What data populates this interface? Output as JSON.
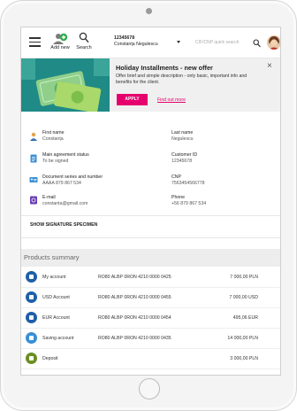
{
  "topbar": {
    "add_new_label": "Add new",
    "search_label": "Search",
    "client_id": "12345678",
    "client_name": "Constanța Negulescu",
    "quick_search_placeholder": "CIF/CNP quick search"
  },
  "banner": {
    "title": "Holiday Installments - new offer",
    "description": "Offer brief and simple description - only basic, important info and benefits for the client.",
    "apply_label": "APPLY",
    "find_out_more": "Find out more",
    "close_symbol": "×"
  },
  "client": {
    "first_name_label": "First name",
    "first_name": "Constanța",
    "last_name_label": "Last name",
    "last_name": "Negulescu",
    "agreement_label": "Main agreement status",
    "agreement_status": "To be signed",
    "customer_id_label": "Customer ID",
    "customer_id": "12345678",
    "document_label": "Document series and number",
    "document_value": "AAAA 879 867 534",
    "cnp_label": "CNP",
    "cnp_value": "7563454566778",
    "email_label": "E-mail",
    "email_value": "constanta@gmail.com",
    "phone_label": "Phone",
    "phone_value": "+56 879 867 534"
  },
  "signature_label": "SHOW SIGNATURE SPECIMEN",
  "products": {
    "title": "Products summary",
    "rows": [
      {
        "name": "My account",
        "iban": "RO80 ALBP 0RON 4210 0000 0425",
        "amount": "7 000,00 PLN",
        "color": "#1f5fa8"
      },
      {
        "name": "USD Account",
        "iban": "RO80 ALBP 0RON 4210 0000 0455",
        "amount": "7 000,00 USD",
        "color": "#1f5fa8"
      },
      {
        "name": "EUR Account",
        "iban": "RO80 ALBP 0RON 4210 0000 0454",
        "amount": "495,06 EUR",
        "color": "#1f5fa8"
      },
      {
        "name": "Saving account",
        "iban": "RO80 ALBP 0RON 4210 0000 0435",
        "amount": "14 000,00 PLN",
        "color": "#3a8fd6"
      },
      {
        "name": "Deposit",
        "iban": "",
        "amount": "3 000,00 PLN",
        "color": "#6b8e23"
      }
    ]
  },
  "colors": {
    "accent": "#e6006e",
    "add_icon": "#2fa84f"
  }
}
